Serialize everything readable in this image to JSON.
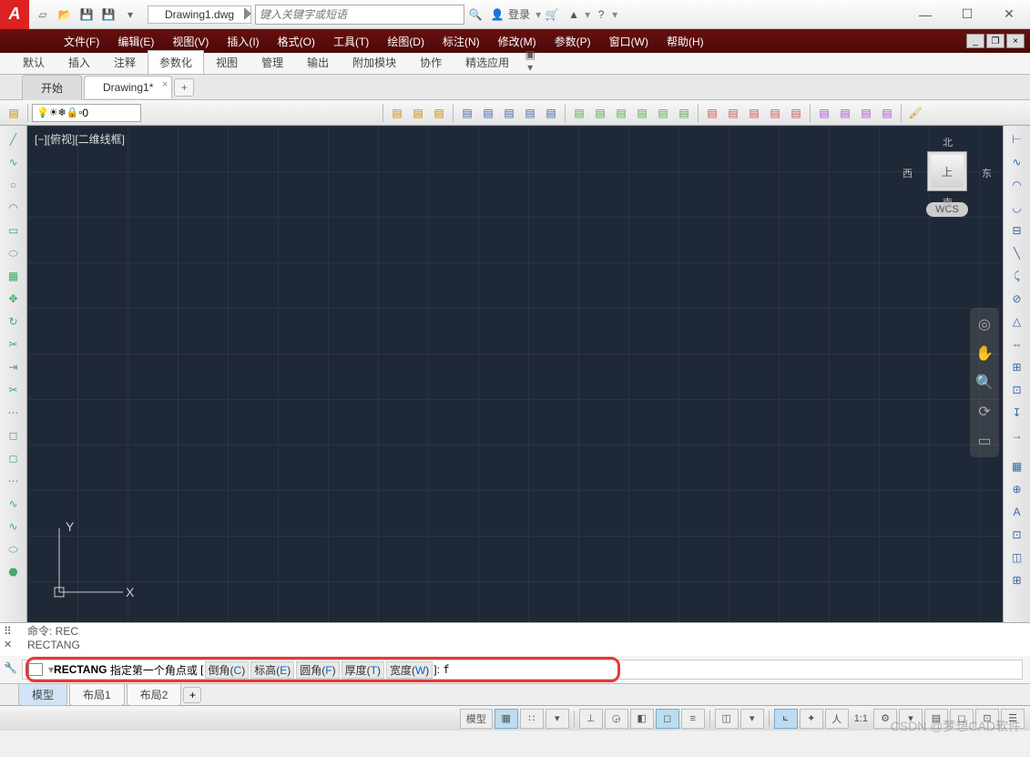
{
  "title": {
    "doc": "Drawing1.dwg",
    "search_placeholder": "键入关键字或短语",
    "login": "登录"
  },
  "menu": [
    "文件(F)",
    "编辑(E)",
    "视图(V)",
    "插入(I)",
    "格式(O)",
    "工具(T)",
    "绘图(D)",
    "标注(N)",
    "修改(M)",
    "参数(P)",
    "窗口(W)",
    "帮助(H)"
  ],
  "ribbon_tabs": [
    "默认",
    "插入",
    "注释",
    "参数化",
    "视图",
    "管理",
    "输出",
    "附加模块",
    "协作",
    "精选应用"
  ],
  "ribbon_active": 3,
  "doc_tabs": {
    "items": [
      {
        "label": "开始",
        "active": false
      },
      {
        "label": "Drawing1*",
        "active": true
      }
    ]
  },
  "layer": {
    "current": "0"
  },
  "viewport": {
    "label": "[−][俯视][二维线框]"
  },
  "viewcube": {
    "n": "北",
    "s": "南",
    "e": "东",
    "w": "西",
    "top": "上",
    "wcs": "WCS"
  },
  "ucs": {
    "x": "X",
    "y": "Y"
  },
  "cmd_history": {
    "l1": "命令: REC",
    "l2": "RECTANG"
  },
  "cmd_line": {
    "cmd": "RECTANG",
    "prompt": "指定第一个角点或",
    "opts": [
      {
        "t": "倒角",
        "k": "C"
      },
      {
        "t": "标高",
        "k": "E"
      },
      {
        "t": "圆角",
        "k": "F"
      },
      {
        "t": "厚度",
        "k": "T"
      },
      {
        "t": "宽度",
        "k": "W"
      }
    ],
    "tail": "]:",
    "input": "f"
  },
  "layout_tabs": [
    {
      "label": "模型",
      "active": true
    },
    {
      "label": "布局1",
      "active": false
    },
    {
      "label": "布局2",
      "active": false
    }
  ],
  "status": {
    "model": "模型",
    "scale": "1:1"
  },
  "watermark": "CSDN @梦想CAD软件"
}
